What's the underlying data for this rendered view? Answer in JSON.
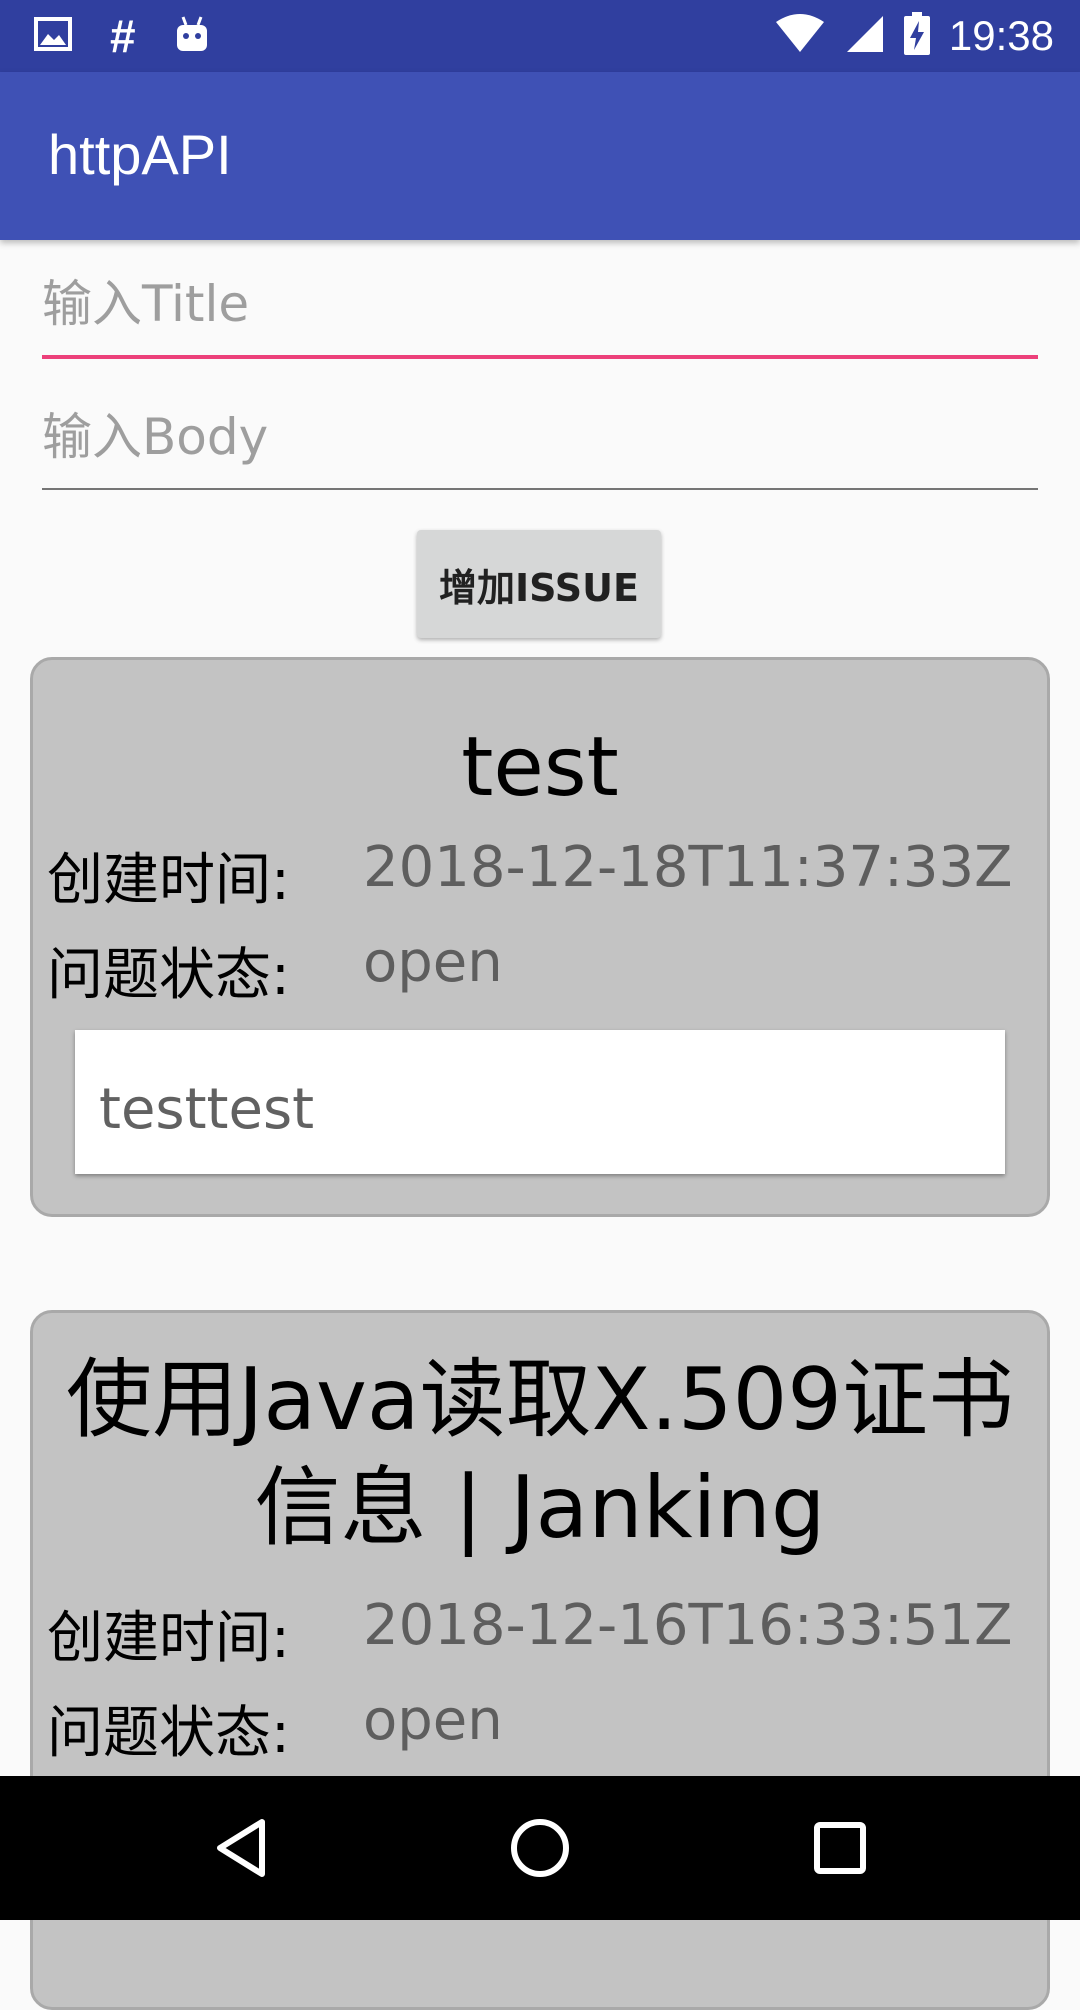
{
  "status_bar": {
    "time": "19:38",
    "left_icons": [
      "image-icon",
      "hash-icon",
      "android-icon"
    ],
    "right_icons": [
      "wifi-icon",
      "signal-icon",
      "battery-charging-icon"
    ]
  },
  "app_bar": {
    "title": "httpAPI"
  },
  "form": {
    "title_placeholder": "输入Title",
    "body_placeholder": "输入Body",
    "add_button_label": "增加ISSUE"
  },
  "issues": [
    {
      "title": "test",
      "created_label": "创建时间:",
      "created_at": "2018-12-18T11:37:33Z",
      "state_label": "问题状态:",
      "state": "open",
      "body": "testtest"
    },
    {
      "title": "使用Java读取X.509证书信息 | Janking",
      "created_label": "创建时间:",
      "created_at": "2018-12-16T16:33:51Z",
      "state_label": "问题状态:",
      "state": "open"
    }
  ],
  "nav_bar": {
    "buttons": [
      "back-icon",
      "home-icon",
      "recents-icon"
    ]
  },
  "colors": {
    "status_bar": "#303f9f",
    "app_bar": "#3f51b5",
    "accent": "#ec407a",
    "card": "#c3c3c3"
  }
}
